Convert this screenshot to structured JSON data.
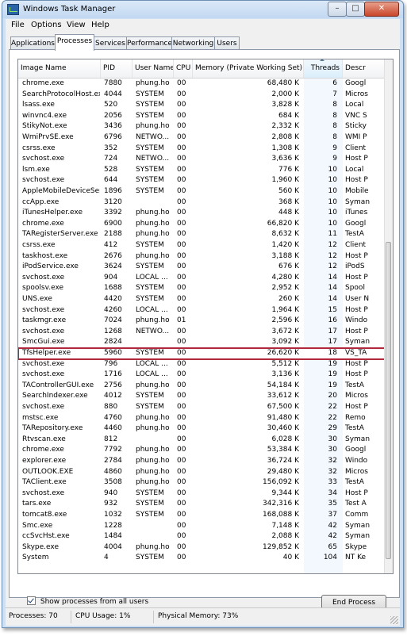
{
  "window": {
    "title": "Windows Task Manager",
    "close_glyph": "✕",
    "min_glyph": "–",
    "max_glyph": "□"
  },
  "menu": [
    "File",
    "Options",
    "View",
    "Help"
  ],
  "tabs": [
    "Applications",
    "Processes",
    "Services",
    "Performance",
    "Networking",
    "Users"
  ],
  "columns": {
    "image_name": "Image Name",
    "pid": "PID",
    "user_name": "User Name",
    "cpu": "CPU",
    "memory": "Memory (Private Working Set)",
    "threads": "Threads",
    "description": "Descr"
  },
  "processes": [
    {
      "name": "chrome.exe",
      "pid": "7880",
      "user": "phung.ho",
      "cpu": "00",
      "mem": "68,480 K",
      "threads": "6",
      "desc": "Googl"
    },
    {
      "name": "SearchProtocolHost.exe",
      "pid": "4044",
      "user": "SYSTEM",
      "cpu": "00",
      "mem": "2,000 K",
      "threads": "7",
      "desc": "Micros"
    },
    {
      "name": "lsass.exe",
      "pid": "520",
      "user": "SYSTEM",
      "cpu": "00",
      "mem": "3,828 K",
      "threads": "8",
      "desc": "Local"
    },
    {
      "name": "winvnc4.exe",
      "pid": "2056",
      "user": "SYSTEM",
      "cpu": "00",
      "mem": "684 K",
      "threads": "8",
      "desc": "VNC S"
    },
    {
      "name": "StikyNot.exe",
      "pid": "3436",
      "user": "phung.ho",
      "cpu": "00",
      "mem": "2,332 K",
      "threads": "8",
      "desc": "Sticky"
    },
    {
      "name": "WmiPrvSE.exe",
      "pid": "6796",
      "user": "NETWO...",
      "cpu": "00",
      "mem": "2,808 K",
      "threads": "8",
      "desc": "WMI P"
    },
    {
      "name": "csrss.exe",
      "pid": "352",
      "user": "SYSTEM",
      "cpu": "00",
      "mem": "1,308 K",
      "threads": "9",
      "desc": "Client"
    },
    {
      "name": "svchost.exe",
      "pid": "724",
      "user": "NETWO...",
      "cpu": "00",
      "mem": "3,636 K",
      "threads": "9",
      "desc": "Host P"
    },
    {
      "name": "lsm.exe",
      "pid": "528",
      "user": "SYSTEM",
      "cpu": "00",
      "mem": "776 K",
      "threads": "10",
      "desc": "Local"
    },
    {
      "name": "svchost.exe",
      "pid": "644",
      "user": "SYSTEM",
      "cpu": "00",
      "mem": "1,960 K",
      "threads": "10",
      "desc": "Host P"
    },
    {
      "name": "AppleMobileDeviceSer...",
      "pid": "1896",
      "user": "SYSTEM",
      "cpu": "00",
      "mem": "560 K",
      "threads": "10",
      "desc": "Mobile"
    },
    {
      "name": "ccApp.exe",
      "pid": "3120",
      "user": "",
      "cpu": "00",
      "mem": "368 K",
      "threads": "10",
      "desc": "Syman"
    },
    {
      "name": "iTunesHelper.exe",
      "pid": "3392",
      "user": "phung.ho",
      "cpu": "00",
      "mem": "448 K",
      "threads": "10",
      "desc": "iTunes"
    },
    {
      "name": "chrome.exe",
      "pid": "6900",
      "user": "phung.ho",
      "cpu": "00",
      "mem": "66,820 K",
      "threads": "10",
      "desc": "Googl"
    },
    {
      "name": "TARegisterServer.exe",
      "pid": "2188",
      "user": "phung.ho",
      "cpu": "00",
      "mem": "8,632 K",
      "threads": "11",
      "desc": "TestA"
    },
    {
      "name": "csrss.exe",
      "pid": "412",
      "user": "SYSTEM",
      "cpu": "00",
      "mem": "1,420 K",
      "threads": "12",
      "desc": "Client"
    },
    {
      "name": "taskhost.exe",
      "pid": "2676",
      "user": "phung.ho",
      "cpu": "00",
      "mem": "3,188 K",
      "threads": "12",
      "desc": "Host P"
    },
    {
      "name": "iPodService.exe",
      "pid": "3624",
      "user": "SYSTEM",
      "cpu": "00",
      "mem": "676 K",
      "threads": "12",
      "desc": "iPodS"
    },
    {
      "name": "svchost.exe",
      "pid": "904",
      "user": "LOCAL ...",
      "cpu": "00",
      "mem": "4,280 K",
      "threads": "14",
      "desc": "Host P"
    },
    {
      "name": "spoolsv.exe",
      "pid": "1688",
      "user": "SYSTEM",
      "cpu": "00",
      "mem": "2,952 K",
      "threads": "14",
      "desc": "Spool"
    },
    {
      "name": "UNS.exe",
      "pid": "4420",
      "user": "SYSTEM",
      "cpu": "00",
      "mem": "260 K",
      "threads": "14",
      "desc": "User N"
    },
    {
      "name": "svchost.exe",
      "pid": "4260",
      "user": "LOCAL ...",
      "cpu": "00",
      "mem": "1,964 K",
      "threads": "15",
      "desc": "Host P"
    },
    {
      "name": "taskmgr.exe",
      "pid": "7024",
      "user": "phung.ho",
      "cpu": "01",
      "mem": "2,596 K",
      "threads": "16",
      "desc": "Windo"
    },
    {
      "name": "svchost.exe",
      "pid": "1268",
      "user": "NETWO...",
      "cpu": "00",
      "mem": "3,672 K",
      "threads": "17",
      "desc": "Host P"
    },
    {
      "name": "SmcGui.exe",
      "pid": "2824",
      "user": "",
      "cpu": "00",
      "mem": "3,092 K",
      "threads": "17",
      "desc": "Syman"
    },
    {
      "name": "TfsHelper.exe",
      "pid": "5960",
      "user": "SYSTEM",
      "cpu": "00",
      "mem": "26,620 K",
      "threads": "18",
      "desc": "VS_TA"
    },
    {
      "name": "svchost.exe",
      "pid": "796",
      "user": "LOCAL ...",
      "cpu": "00",
      "mem": "5,512 K",
      "threads": "19",
      "desc": "Host P"
    },
    {
      "name": "svchost.exe",
      "pid": "1716",
      "user": "LOCAL ...",
      "cpu": "00",
      "mem": "3,136 K",
      "threads": "19",
      "desc": "Host P"
    },
    {
      "name": "TAControllerGUI.exe",
      "pid": "2756",
      "user": "phung.ho",
      "cpu": "00",
      "mem": "54,184 K",
      "threads": "19",
      "desc": "TestA"
    },
    {
      "name": "SearchIndexer.exe",
      "pid": "4012",
      "user": "SYSTEM",
      "cpu": "00",
      "mem": "33,612 K",
      "threads": "20",
      "desc": "Micros"
    },
    {
      "name": "svchost.exe",
      "pid": "880",
      "user": "SYSTEM",
      "cpu": "00",
      "mem": "67,500 K",
      "threads": "22",
      "desc": "Host P"
    },
    {
      "name": "mstsc.exe",
      "pid": "4760",
      "user": "phung.ho",
      "cpu": "00",
      "mem": "91,480 K",
      "threads": "22",
      "desc": "Remo"
    },
    {
      "name": "TARepository.exe",
      "pid": "4460",
      "user": "phung.ho",
      "cpu": "00",
      "mem": "30,460 K",
      "threads": "29",
      "desc": "TestA"
    },
    {
      "name": "Rtvscan.exe",
      "pid": "812",
      "user": "",
      "cpu": "00",
      "mem": "6,028 K",
      "threads": "30",
      "desc": "Syman"
    },
    {
      "name": "chrome.exe",
      "pid": "7792",
      "user": "phung.ho",
      "cpu": "00",
      "mem": "53,384 K",
      "threads": "30",
      "desc": "Googl"
    },
    {
      "name": "explorer.exe",
      "pid": "2784",
      "user": "phung.ho",
      "cpu": "00",
      "mem": "36,724 K",
      "threads": "32",
      "desc": "Windo"
    },
    {
      "name": "OUTLOOK.EXE",
      "pid": "4860",
      "user": "phung.ho",
      "cpu": "00",
      "mem": "29,480 K",
      "threads": "32",
      "desc": "Micros"
    },
    {
      "name": "TAClient.exe",
      "pid": "3508",
      "user": "phung.ho",
      "cpu": "00",
      "mem": "156,092 K",
      "threads": "33",
      "desc": "TestA"
    },
    {
      "name": "svchost.exe",
      "pid": "940",
      "user": "SYSTEM",
      "cpu": "00",
      "mem": "9,344 K",
      "threads": "34",
      "desc": "Host P"
    },
    {
      "name": "tars.exe",
      "pid": "932",
      "user": "SYSTEM",
      "cpu": "00",
      "mem": "342,316 K",
      "threads": "35",
      "desc": "Test A"
    },
    {
      "name": "tomcat8.exe",
      "pid": "1032",
      "user": "SYSTEM",
      "cpu": "00",
      "mem": "168,088 K",
      "threads": "37",
      "desc": "Comm"
    },
    {
      "name": "Smc.exe",
      "pid": "1228",
      "user": "",
      "cpu": "00",
      "mem": "7,148 K",
      "threads": "42",
      "desc": "Syman"
    },
    {
      "name": "ccSvcHst.exe",
      "pid": "1484",
      "user": "",
      "cpu": "00",
      "mem": "2,088 K",
      "threads": "42",
      "desc": "Syman"
    },
    {
      "name": "Skype.exe",
      "pid": "4004",
      "user": "phung.ho",
      "cpu": "00",
      "mem": "129,852 K",
      "threads": "65",
      "desc": "Skype"
    },
    {
      "name": "System",
      "pid": "4",
      "user": "SYSTEM",
      "cpu": "00",
      "mem": "40 K",
      "threads": "104",
      "desc": "NT Ke"
    }
  ],
  "selected_index": 25,
  "show_all_users": {
    "label": "Show processes from all users",
    "checked": true
  },
  "end_process_label": "End Process",
  "status": {
    "processes": "Processes: 70",
    "cpu": "CPU Usage: 1%",
    "memory": "Physical Memory: 73%"
  },
  "colors": {
    "selected_outline": "#b2273b",
    "title_bar": "#c2d8f1",
    "close_button": "#c9452a"
  }
}
